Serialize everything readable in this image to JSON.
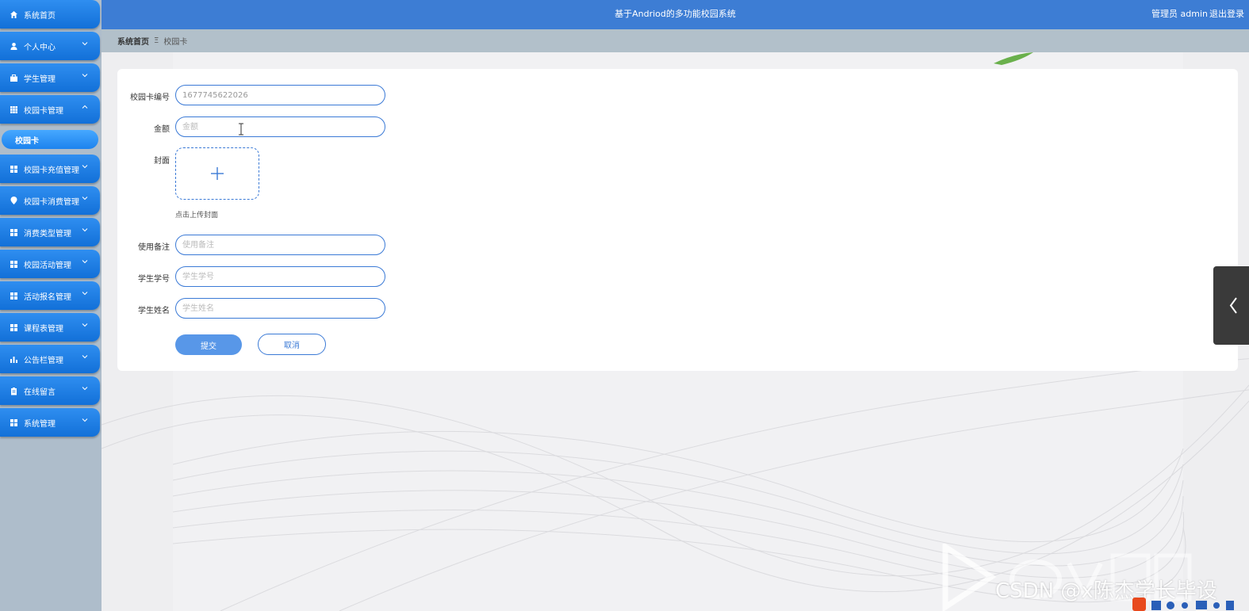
{
  "header": {
    "title": "基于Andriod的多功能校园系统",
    "user": "管理员 admin",
    "logout": "退出登录"
  },
  "breadcrumb": {
    "home": "系统首页",
    "separator": "Ξ",
    "current": "校园卡"
  },
  "sidebar": {
    "items": [
      {
        "label": "系统首页",
        "icon": "home-icon"
      },
      {
        "label": "个人中心",
        "icon": "user-icon"
      },
      {
        "label": "学生管理",
        "icon": "bag-icon"
      },
      {
        "label": "校园卡管理",
        "icon": "grid-icon"
      },
      {
        "label": "校园卡充值管理",
        "icon": "grid-icon"
      },
      {
        "label": "校园卡消费管理",
        "icon": "location-icon"
      },
      {
        "label": "消费类型管理",
        "icon": "grid-icon"
      },
      {
        "label": "校园活动管理",
        "icon": "grid-icon"
      },
      {
        "label": "活动报名管理",
        "icon": "grid-icon"
      },
      {
        "label": "课程表管理",
        "icon": "grid-icon"
      },
      {
        "label": "公告栏管理",
        "icon": "chart-icon"
      },
      {
        "label": "在线留言",
        "icon": "clipboard-icon"
      },
      {
        "label": "系统管理",
        "icon": "grid-icon"
      }
    ],
    "active_sub": "校园卡"
  },
  "form": {
    "card_number": {
      "label": "校园卡编号",
      "value": "1677745622026"
    },
    "amount": {
      "label": "金额",
      "placeholder": "金额"
    },
    "cover": {
      "label": "封面",
      "hint": "点击上传封面"
    },
    "usage_note": {
      "label": "使用备注",
      "placeholder": "使用备注"
    },
    "student_id": {
      "label": "学生学号",
      "placeholder": "学生学号"
    },
    "student_name": {
      "label": "学生姓名",
      "placeholder": "学生姓名"
    },
    "submit": "提交",
    "cancel": "取消"
  },
  "watermark": "CSDN @x陈杰学长毕设",
  "colors": {
    "header": "#3d7dd4",
    "sidebar_item": "#1270d8",
    "accent": "#3b7ad6",
    "submit": "#5897e8"
  }
}
